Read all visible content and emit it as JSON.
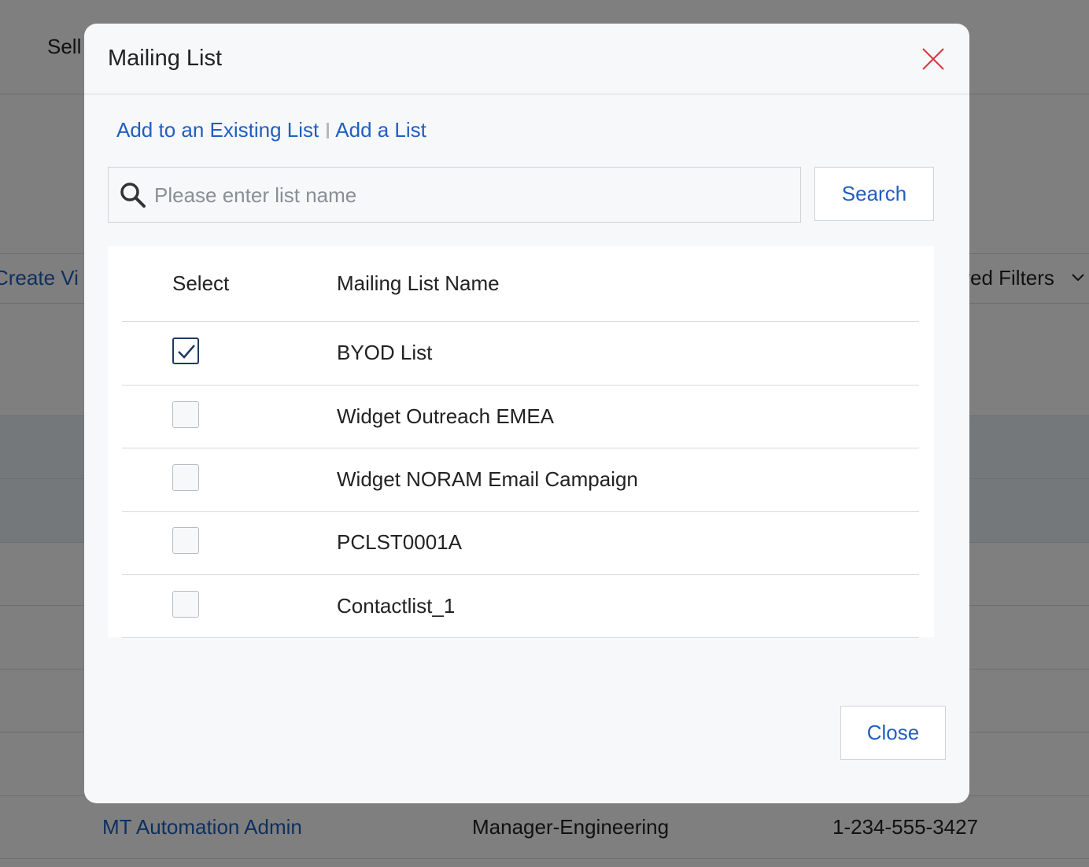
{
  "background": {
    "header_text": "Sell",
    "create_view": "Create Vi",
    "saved_filters": "ved Filters",
    "row": {
      "name": "MT Automation Admin",
      "title": "Manager-Engineering",
      "phone": "1-234-555-3427"
    }
  },
  "modal": {
    "title": "Mailing List",
    "tabs": [
      "Add to an Existing List",
      "Add a List"
    ],
    "search": {
      "placeholder": "Please enter list name",
      "value": "",
      "button_label": "Search"
    },
    "table": {
      "columns": [
        "Select",
        "Mailing List Name"
      ],
      "rows": [
        {
          "name": "BYOD List",
          "checked": true
        },
        {
          "name": "Widget Outreach EMEA",
          "checked": false
        },
        {
          "name": "Widget NORAM Email Campaign",
          "checked": false
        },
        {
          "name": "PCLST0001A",
          "checked": false
        },
        {
          "name": "Contactlist_1",
          "checked": false
        }
      ]
    },
    "close_label": "Close"
  },
  "colors": {
    "link": "#1f5fbf",
    "close_icon": "#d9363e",
    "checkbox_checked": "#1e3a5f"
  },
  "icons": {
    "close": "close-icon",
    "search": "search-icon",
    "check": "check-icon",
    "chevron": "chevron-down-icon"
  }
}
